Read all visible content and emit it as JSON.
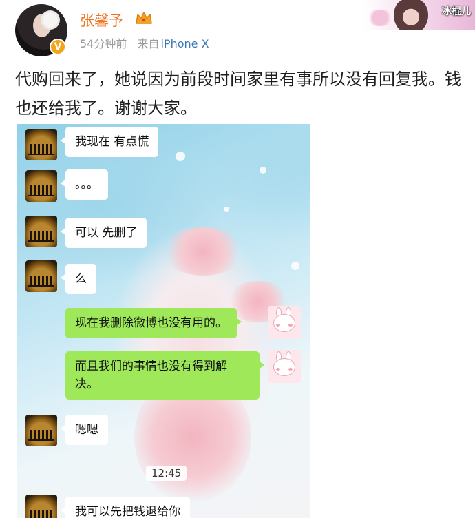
{
  "header": {
    "username": "张馨予",
    "time_ago": "54分钟前",
    "source_prefix": "来自",
    "source_device": "iPhone X",
    "verified_badge": "V"
  },
  "thumbnail": {
    "tag": "冰棍儿"
  },
  "post": {
    "text": "代购回来了，她说因为前段时间家里有事所以没有回复我。钱也还给我了。谢谢大家。"
  },
  "chat": {
    "messages": [
      {
        "side": "in",
        "text": "我现在 有点慌"
      },
      {
        "side": "in",
        "text": "。。。"
      },
      {
        "side": "in",
        "text": "可以 先删了"
      },
      {
        "side": "in",
        "text": "么"
      },
      {
        "side": "out",
        "text": "现在我删除微博也没有用的。"
      },
      {
        "side": "out",
        "text": "而且我们的事情也没有得到解决。"
      },
      {
        "side": "in",
        "text": "嗯嗯"
      },
      {
        "side": "in",
        "text": "我可以先把钱退给你"
      }
    ],
    "timestamp": "12:45"
  },
  "icons": {
    "crown": "crown-icon",
    "verify": "verified-badge-icon"
  },
  "colors": {
    "username": "#f0721f",
    "link": "#3d78b5",
    "bubble_out": "#9ee85a",
    "bubble_in": "#ffffff"
  }
}
